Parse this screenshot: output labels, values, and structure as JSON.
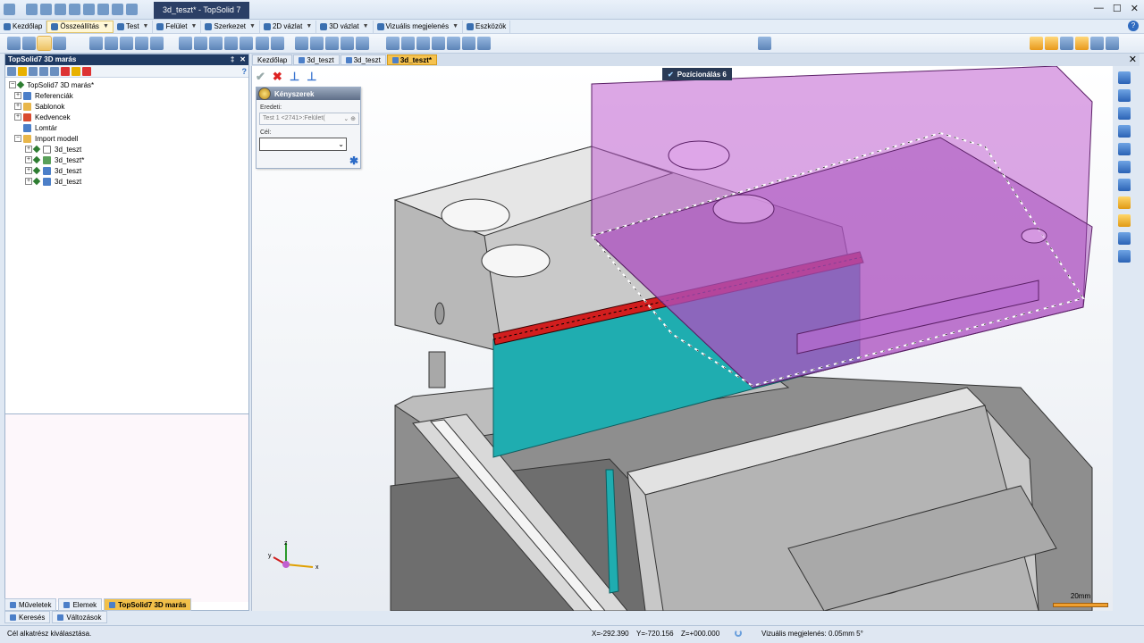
{
  "window": {
    "title": "3d_teszt* - TopSolid 7",
    "controls": [
      "—",
      "☐",
      "✕"
    ]
  },
  "menu": {
    "items": [
      {
        "label": "Kezdőlap",
        "icon": "home-icon"
      },
      {
        "label": "Összeállítás",
        "icon": "assembly-icon",
        "active": true
      },
      {
        "label": "Test",
        "icon": "body-icon"
      },
      {
        "label": "Felület",
        "icon": "surface-icon"
      },
      {
        "label": "Szerkezet",
        "icon": "structure-icon"
      },
      {
        "label": "2D vázlat",
        "icon": "sketch-2d-icon"
      },
      {
        "label": "3D vázlat",
        "icon": "sketch-3d-icon"
      },
      {
        "label": "Vizuális megjelenés",
        "icon": "visual-icon"
      },
      {
        "label": "Eszközök",
        "icon": "tools-icon"
      }
    ],
    "help": "?"
  },
  "left_panel": {
    "title": "TopSolid7 3D marás",
    "help": "?",
    "tree": [
      {
        "label": "TopSolid7 3D marás*",
        "level": 0,
        "icon": "project-icon"
      },
      {
        "label": "Referenciák",
        "level": 1,
        "icon": "references-icon"
      },
      {
        "label": "Sablonok",
        "level": 1,
        "icon": "templates-icon"
      },
      {
        "label": "Kedvencek",
        "level": 1,
        "icon": "favorites-icon"
      },
      {
        "label": "Lomtár",
        "level": 1,
        "icon": "trash-icon"
      },
      {
        "label": "Import modell",
        "level": 1,
        "icon": "folder-icon"
      },
      {
        "label": "3d_teszt",
        "level": 2,
        "icon": "document-icon"
      },
      {
        "label": "3d_teszt*",
        "level": 2,
        "icon": "assembly-doc-icon"
      },
      {
        "label": "3d_teszt",
        "level": 2,
        "icon": "part-doc-icon"
      },
      {
        "label": "3d_teszt",
        "level": 2,
        "icon": "cam-doc-icon"
      }
    ],
    "tabs": [
      {
        "label": "Műveletek"
      },
      {
        "label": "Elemek"
      },
      {
        "label": "TopSolid7 3D marás",
        "active": true
      }
    ],
    "tabs2": [
      {
        "label": "Keresés"
      },
      {
        "label": "Változások"
      }
    ]
  },
  "doc_tabs": [
    {
      "label": "Kezdőlap"
    },
    {
      "label": "3d_teszt"
    },
    {
      "label": "3d_teszt"
    },
    {
      "label": "3d_teszt*",
      "active": true
    }
  ],
  "dialog": {
    "title": "Kényszerek",
    "origin_label": "Eredeti:",
    "origin_value": "Test 1 <2741>:Felület(",
    "target_label": "Cél:",
    "target_value": ""
  },
  "positioning": {
    "title": "Pozícionálás 6"
  },
  "scale": {
    "label": "20mm"
  },
  "triad": {
    "x": "x",
    "y": "y",
    "z": "z"
  },
  "status": {
    "message": "Cél alkatrész kiválasztása.",
    "x": "X=-292.390",
    "y": "Y=-720.156",
    "z": "Z=+000.000",
    "visual": "Vizuális megjelenés: 0.05mm 5°"
  },
  "colors": {
    "accent": "#f5c24f",
    "highlight_face": "#1fadb0",
    "ghost_part": "#c05fd0",
    "edge_selection": "#d11e1e"
  }
}
